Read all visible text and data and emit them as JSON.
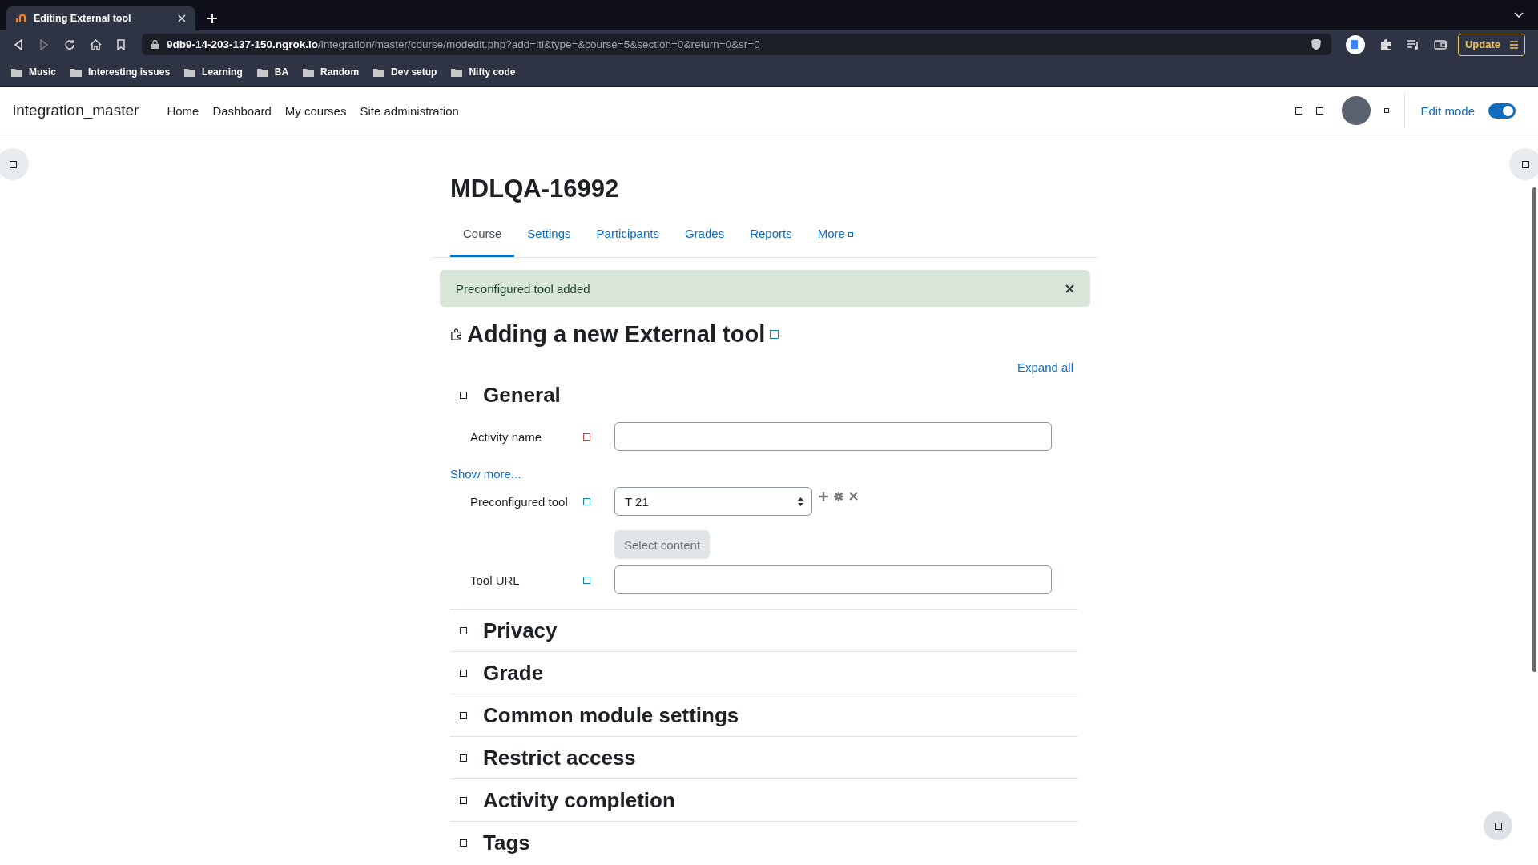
{
  "browser": {
    "tab": {
      "title": "Editing External tool"
    },
    "url": {
      "host": "9db9-14-203-137-150.ngrok.io",
      "path": "/integration/master/course/modedit.php?add=lti&type=&course=5&section=0&return=0&sr=0"
    },
    "update_button": "Update",
    "bookmarks": [
      "Music",
      "Interesting issues",
      "Learning",
      "BA",
      "Random",
      "Dev setup",
      "Nifty code"
    ]
  },
  "navbar": {
    "site_name": "integration_master",
    "links": [
      "Home",
      "Dashboard",
      "My courses",
      "Site administration"
    ],
    "edit_mode": {
      "label": "Edit mode",
      "on": true
    }
  },
  "course_title": "MDLQA-16992",
  "tabs": [
    {
      "label": "Course",
      "selected": true
    },
    {
      "label": "Settings",
      "selected": false
    },
    {
      "label": "Participants",
      "selected": false
    },
    {
      "label": "Grades",
      "selected": false
    },
    {
      "label": "Reports",
      "selected": false
    },
    {
      "label": "More",
      "selected": false
    }
  ],
  "alert": {
    "message": "Preconfigured tool added"
  },
  "page_heading": "Adding a new External tool",
  "expand_all": "Expand all",
  "sections": [
    {
      "title": "General"
    },
    {
      "title": "Privacy"
    },
    {
      "title": "Grade"
    },
    {
      "title": "Common module settings"
    },
    {
      "title": "Restrict access"
    },
    {
      "title": "Activity completion"
    },
    {
      "title": "Tags"
    }
  ],
  "general": {
    "activity_name": {
      "label": "Activity name",
      "color": "#d43f3a"
    },
    "show_more": "Show more...",
    "preconfigured_tool": {
      "label": "Preconfigured tool",
      "color": "#0f8a9d",
      "value": "T 21"
    },
    "select_content": {
      "label": "Select content",
      "disabled": true
    },
    "tool_url": {
      "label": "Tool URL",
      "color": "#0f8a9d"
    }
  }
}
